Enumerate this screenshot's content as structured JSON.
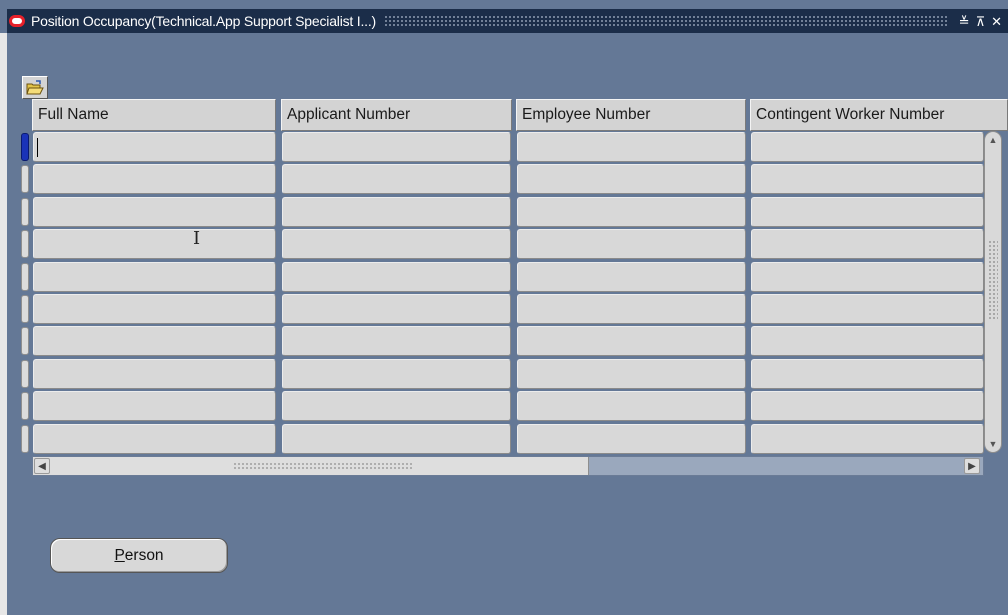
{
  "window": {
    "title": "Position Occupancy(Technical.App Support Specialist I...)",
    "controls": {
      "minimize": "≚",
      "maximize": "⊼",
      "close": "✕"
    }
  },
  "toolbar": {
    "open_folder_icon": "folder-open-icon"
  },
  "table": {
    "columns": [
      {
        "label": "Full Name"
      },
      {
        "label": "Applicant Number"
      },
      {
        "label": "Employee Number"
      },
      {
        "label": "Contingent Worker Number"
      }
    ],
    "rows": [
      [
        "",
        "",
        "",
        ""
      ],
      [
        "",
        "",
        "",
        ""
      ],
      [
        "",
        "",
        "",
        ""
      ],
      [
        "",
        "",
        "",
        ""
      ],
      [
        "",
        "",
        "",
        ""
      ],
      [
        "",
        "",
        "",
        ""
      ],
      [
        "",
        "",
        "",
        ""
      ],
      [
        "",
        "",
        "",
        ""
      ],
      [
        "",
        "",
        "",
        ""
      ],
      [
        "",
        "",
        "",
        ""
      ]
    ],
    "active_row": 0
  },
  "buttons": {
    "person": {
      "mnemonic": "P",
      "rest": "erson"
    }
  },
  "colors": {
    "background": "#647896",
    "titlebar": "#1b2d49",
    "cell": "#d8d8d8",
    "active_selector": "#1a33b8"
  }
}
